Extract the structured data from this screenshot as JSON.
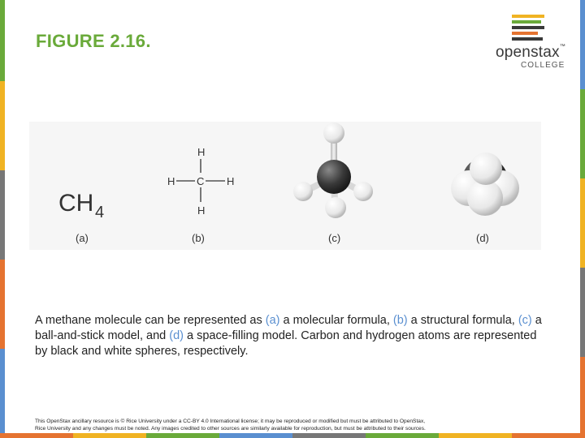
{
  "slide": {
    "title": "FIGURE 2.16.",
    "accent_color": "#6aaa3a"
  },
  "logo": {
    "wordmark": "openstax",
    "trademark": "™",
    "subtitle": "COLLEGE",
    "bar_colors": [
      "#f0b323",
      "#6aaa3a",
      "#3a3a3a",
      "#e57330",
      "#3a3a3a"
    ]
  },
  "figure": {
    "molecular_formula": {
      "main": "CH",
      "subscript": "4"
    },
    "structural_atoms": {
      "top": "H",
      "left": "H",
      "center": "C",
      "right": "H",
      "bottom": "H"
    },
    "panel_labels": [
      "(a)",
      "(b)",
      "(c)",
      "(d)"
    ]
  },
  "caption": {
    "part1": "A methane molecule can be represented as ",
    "a": "(a)",
    "part2": " a molecular formula, ",
    "b": "(b)",
    "part3": " a structural formula, ",
    "c": "(c)",
    "part4": " a ball-and-stick model, and ",
    "d": "(d)",
    "part5": " a space-filling model. Carbon and hydrogen atoms are represented by black and white spheres, respectively."
  },
  "footer": {
    "line1": "This OpenStax ancillary resource is © Rice University under a CC-BY 4.0 International license; it may be reproduced or modified but must be attributed to OpenStax,",
    "line2": "Rice University and any changes must be noted. Any images credited to other sources are similarly available for reproduction, but must be attributed to their sources."
  },
  "edge_colors": [
    "#e57330",
    "#f0b323",
    "#6aaa3a",
    "#5a8fd0",
    "#777777"
  ]
}
